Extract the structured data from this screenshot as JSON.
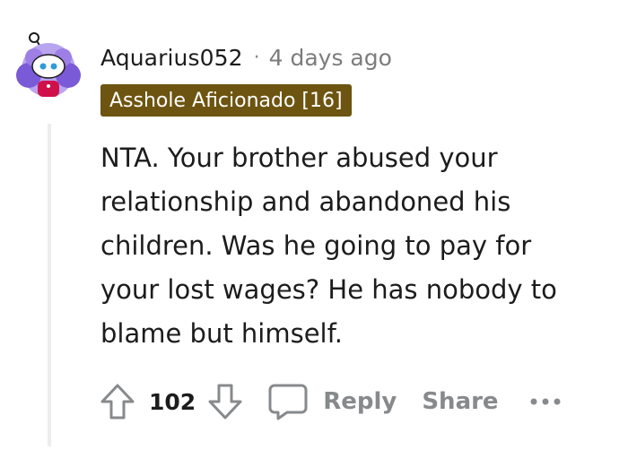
{
  "comment": {
    "author": "Aquarius052",
    "separator": "·",
    "timestamp": "4 days ago",
    "flair": "Asshole Aficionado [16]",
    "flair_color": "#6d5410",
    "body_lines": [
      "NTA. Your brother abused your",
      "relationship and abandoned his",
      "children. Was he going to pay for",
      "your lost wages? He has nobody to",
      "blame but himself."
    ],
    "score": "102",
    "actions": {
      "reply_label": "Reply",
      "share_label": "Share"
    },
    "icons": {
      "avatar": "snoo-avatar-icon",
      "upvote": "upvote-arrow-icon",
      "downvote": "downvote-arrow-icon",
      "reply": "speech-bubble-icon",
      "more": "ellipsis-icon"
    }
  }
}
